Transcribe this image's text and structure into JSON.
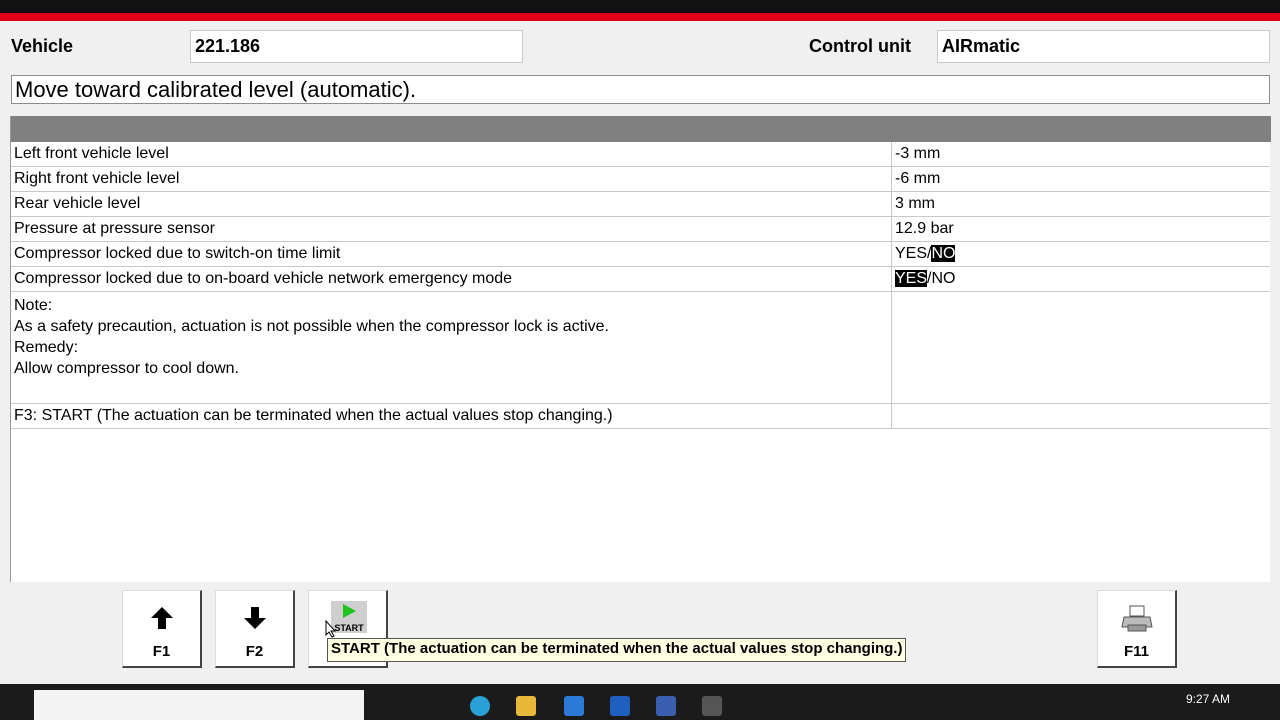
{
  "header": {
    "vehicle_label": "Vehicle",
    "vehicle_value": "221.186",
    "control_unit_label": "Control unit",
    "control_unit_value": "AIRmatic"
  },
  "title": "Move toward calibrated level (automatic).",
  "rows": [
    {
      "label": "Left front vehicle level",
      "value": "-3 mm"
    },
    {
      "label": "Right front vehicle level",
      "value": "-6 mm"
    },
    {
      "label": "Rear vehicle level",
      "value": "3 mm"
    },
    {
      "label": "Pressure at pressure sensor",
      "value": "12.9 bar"
    }
  ],
  "status_rows": [
    {
      "label": "Compressor locked due to switch-on time limit",
      "yes": "YES",
      "sep": "/",
      "no": "NO",
      "selected": "NO"
    },
    {
      "label": "Compressor locked due to on-board vehicle network emergency mode",
      "yes": "YES",
      "sep": "/",
      "no": "NO",
      "selected": "YES"
    }
  ],
  "note": {
    "line1": "Note:",
    "line2": "As a safety precaution, actuation is not possible when the compressor lock is active.",
    "line3": "Remedy:",
    "line4": "Allow compressor to cool down."
  },
  "instruction": "F3: START (The actuation can be terminated when the actual values stop changing.)",
  "fkeys": {
    "f1": {
      "label": "F1",
      "icon": "arrow-up-icon"
    },
    "f2": {
      "label": "F2",
      "icon": "arrow-down-icon"
    },
    "f3": {
      "label": "START",
      "icon": "play-icon"
    },
    "f11": {
      "label": "F11",
      "icon": "printer-icon"
    }
  },
  "tooltip": "START (The actuation can be terminated when the actual values stop changing.)",
  "taskbar": {
    "clock": "9:27 AM"
  },
  "colors": {
    "accent_red": "#e0001a",
    "header_gray": "#808080",
    "highlight": "#000000"
  }
}
